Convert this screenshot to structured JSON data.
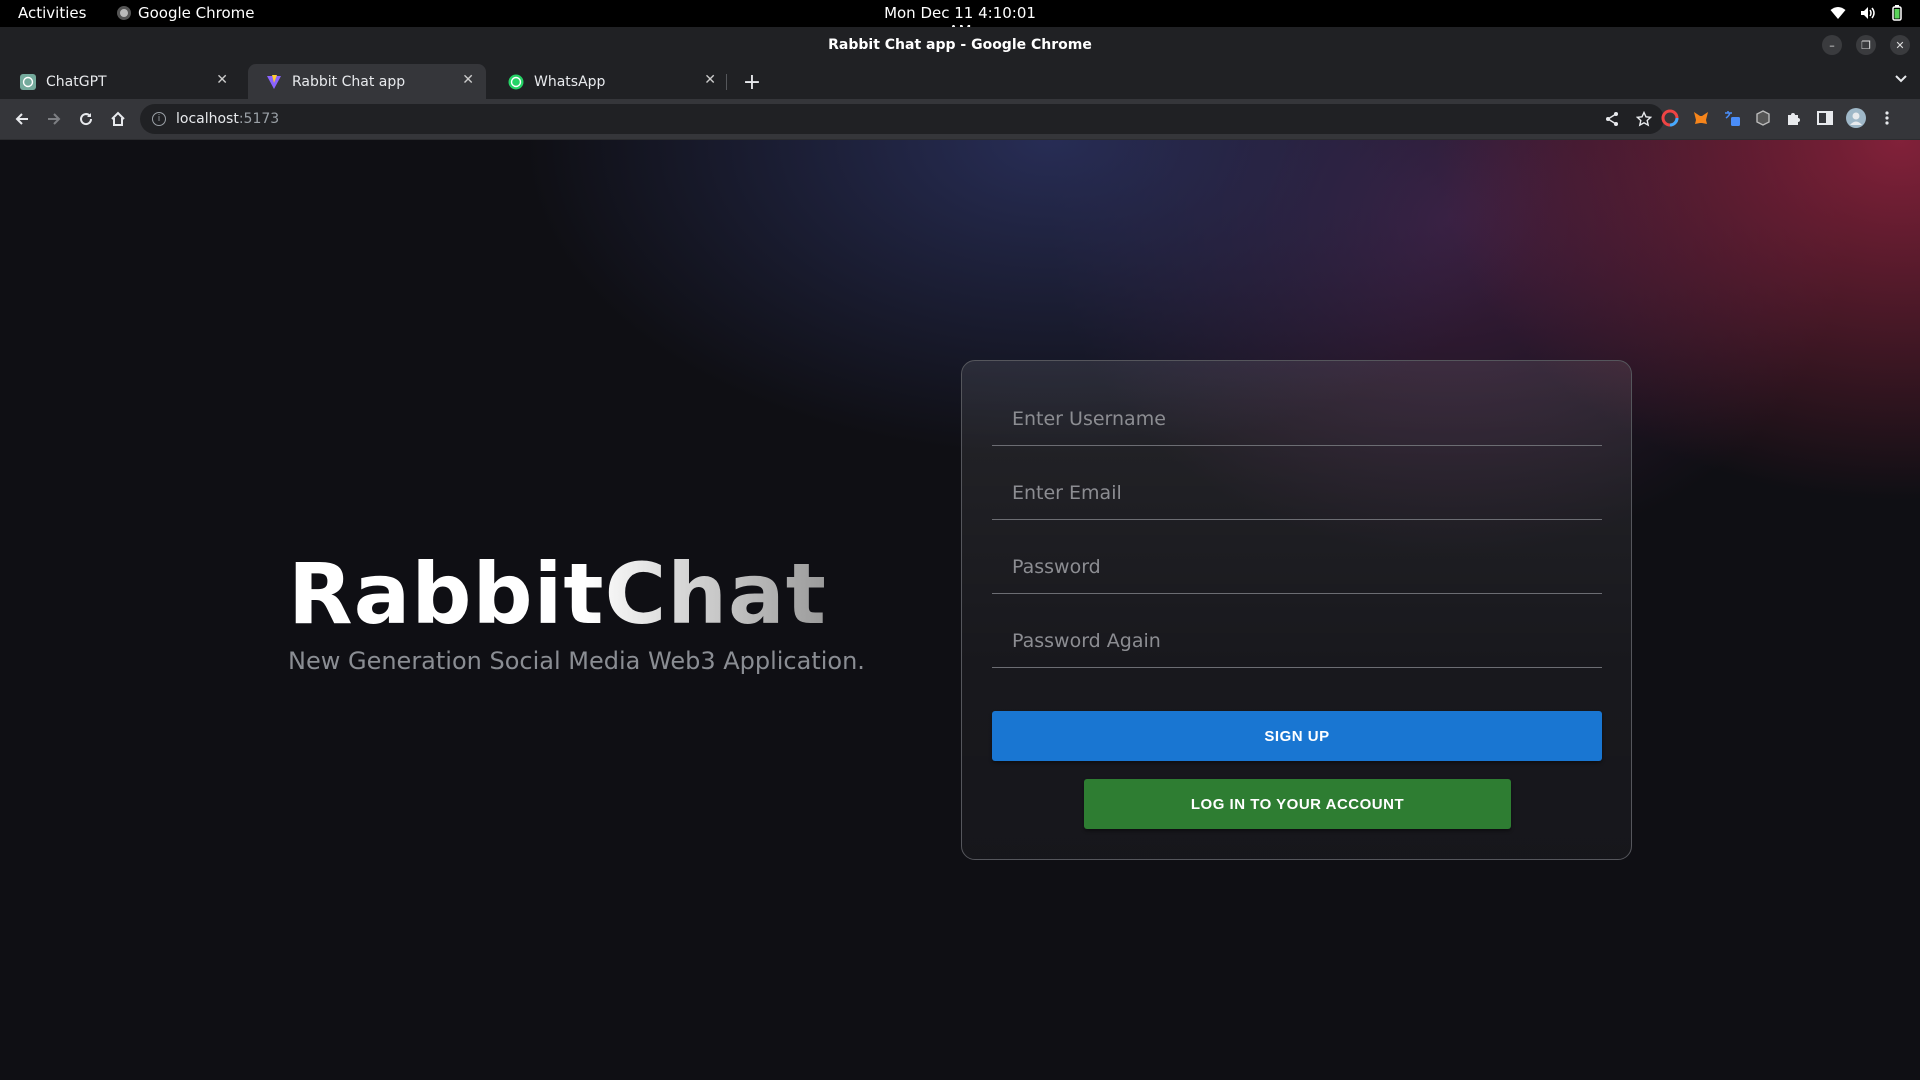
{
  "system_bar": {
    "activities": "Activities",
    "app_name": "Google Chrome",
    "clock": "Mon Dec 11  4:10:01 AM",
    "tray_icons": [
      "wifi-icon",
      "volume-icon",
      "battery-icon"
    ]
  },
  "window": {
    "title": "Rabbit Chat app - Google Chrome"
  },
  "tabs": [
    {
      "label": "ChatGPT",
      "icon": "chatgpt-favicon",
      "active": false
    },
    {
      "label": "Rabbit Chat app",
      "icon": "vite-favicon",
      "active": true
    },
    {
      "label": "WhatsApp",
      "icon": "whatsapp-favicon",
      "active": false
    }
  ],
  "address_bar": {
    "host": "localhost",
    "port": ":5173"
  },
  "page": {
    "brand_title": "RabbitChat",
    "tagline": "New Generation Social Media Web3 Application.",
    "form": {
      "username_placeholder": "Enter Username",
      "email_placeholder": "Enter Email",
      "password_placeholder": "Password",
      "password_again_placeholder": "Password Again",
      "signup_label": "SIGN UP",
      "login_label": "LOG IN TO YOUR ACCOUNT"
    }
  },
  "colors": {
    "signup_button": "#1976d2",
    "login_button": "#2e7d32",
    "page_background": "#0f0f14",
    "accent_red_glow": "#962440",
    "accent_blue_glow": "#2a305c"
  }
}
